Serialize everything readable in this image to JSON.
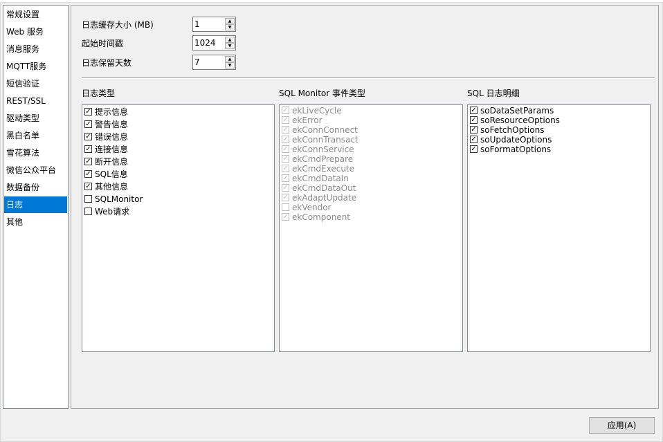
{
  "sidebar": {
    "items": [
      {
        "label": "常规设置",
        "selected": false
      },
      {
        "label": "Web 服务",
        "selected": false
      },
      {
        "label": "消息服务",
        "selected": false
      },
      {
        "label": "MQTT服务",
        "selected": false
      },
      {
        "label": "短信验证",
        "selected": false
      },
      {
        "label": "REST/SSL",
        "selected": false
      },
      {
        "label": "驱动类型",
        "selected": false
      },
      {
        "label": "黑白名单",
        "selected": false
      },
      {
        "label": "雪花算法",
        "selected": false
      },
      {
        "label": "微信公众平台",
        "selected": false
      },
      {
        "label": "数据备份",
        "selected": false
      },
      {
        "label": "日志",
        "selected": true
      },
      {
        "label": "其他",
        "selected": false
      }
    ]
  },
  "settings": {
    "cache_size": {
      "label": "日志缓存大小 (MB)",
      "value": "1"
    },
    "start_time": {
      "label": "起始时间戳",
      "value": "1024"
    },
    "retention_days": {
      "label": "日志保留天数",
      "value": "7"
    }
  },
  "log_types": {
    "title": "日志类型",
    "items": [
      {
        "label": "提示信息",
        "checked": true
      },
      {
        "label": "警告信息",
        "checked": true
      },
      {
        "label": "错误信息",
        "checked": true
      },
      {
        "label": "连接信息",
        "checked": true
      },
      {
        "label": "断开信息",
        "checked": true
      },
      {
        "label": "SQL信息",
        "checked": true
      },
      {
        "label": "其他信息",
        "checked": true
      },
      {
        "label": "SQLMonitor",
        "checked": false
      },
      {
        "label": "Web请求",
        "checked": false
      }
    ]
  },
  "sql_monitor_events": {
    "title": "SQL Monitor 事件类型",
    "disabled": true,
    "items": [
      {
        "label": "ekLiveCycle",
        "checked": true
      },
      {
        "label": "ekError",
        "checked": true
      },
      {
        "label": "ekConnConnect",
        "checked": true
      },
      {
        "label": "ekConnTransact",
        "checked": true
      },
      {
        "label": "ekConnService",
        "checked": true
      },
      {
        "label": "ekCmdPrepare",
        "checked": true
      },
      {
        "label": "ekCmdExecute",
        "checked": true
      },
      {
        "label": "ekCmdDataIn",
        "checked": true
      },
      {
        "label": "ekCmdDataOut",
        "checked": true
      },
      {
        "label": "ekAdaptUpdate",
        "checked": true
      },
      {
        "label": "ekVendor",
        "checked": false
      },
      {
        "label": "ekComponent",
        "checked": true
      }
    ]
  },
  "sql_log_details": {
    "title": "SQL 日志明细",
    "items": [
      {
        "label": "soDataSetParams",
        "checked": true
      },
      {
        "label": "soResourceOptions",
        "checked": true
      },
      {
        "label": "soFetchOptions",
        "checked": true
      },
      {
        "label": "soUpdateOptions",
        "checked": true
      },
      {
        "label": "soFormatOptions",
        "checked": true
      }
    ]
  },
  "footer": {
    "apply_label": "应用(A)"
  },
  "icons": {
    "check": "check-icon",
    "spin_up": "arrow-up-icon",
    "spin_down": "arrow-down-icon"
  },
  "colors": {
    "selection": "#0078d7",
    "panel_bg": "#f0f0f0"
  }
}
